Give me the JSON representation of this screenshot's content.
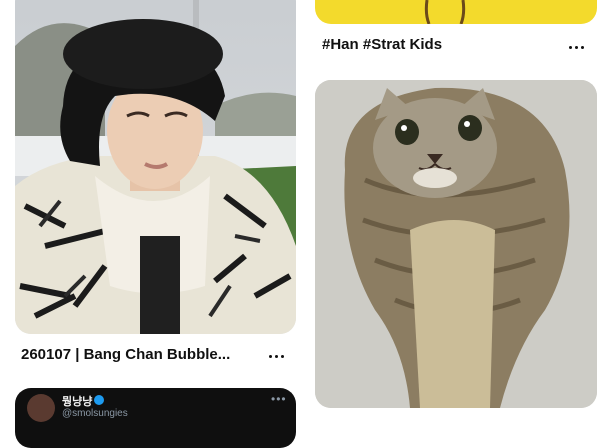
{
  "pins": [
    {
      "id": "pin-left-1",
      "title": "260107 | Bang Chan Bubble...",
      "image_alt": "person in a black fur trapper hat and a black-and-white patterned puffer jacket, snowy field behind"
    },
    {
      "id": "pin-right-0",
      "title": "#Han #Strat Kids",
      "image_alt": "yellow garment with a drawstring"
    },
    {
      "id": "pin-right-1",
      "title": "",
      "image_alt": "cat face edited onto a cobra's hood"
    },
    {
      "id": "pin-left-2",
      "title": "",
      "image_alt": "screenshot of a post"
    }
  ],
  "tweet_card": {
    "display_name": "뭥냥냥",
    "handle": "@smolsungies"
  },
  "more_icon": "more-horizontal-icon",
  "colors": {
    "background": "#ffffff",
    "text": "#111111",
    "yellow_pin": "#f3da2c",
    "tweet_bg": "#0f0f0f",
    "verified": "#1d9bf0"
  }
}
